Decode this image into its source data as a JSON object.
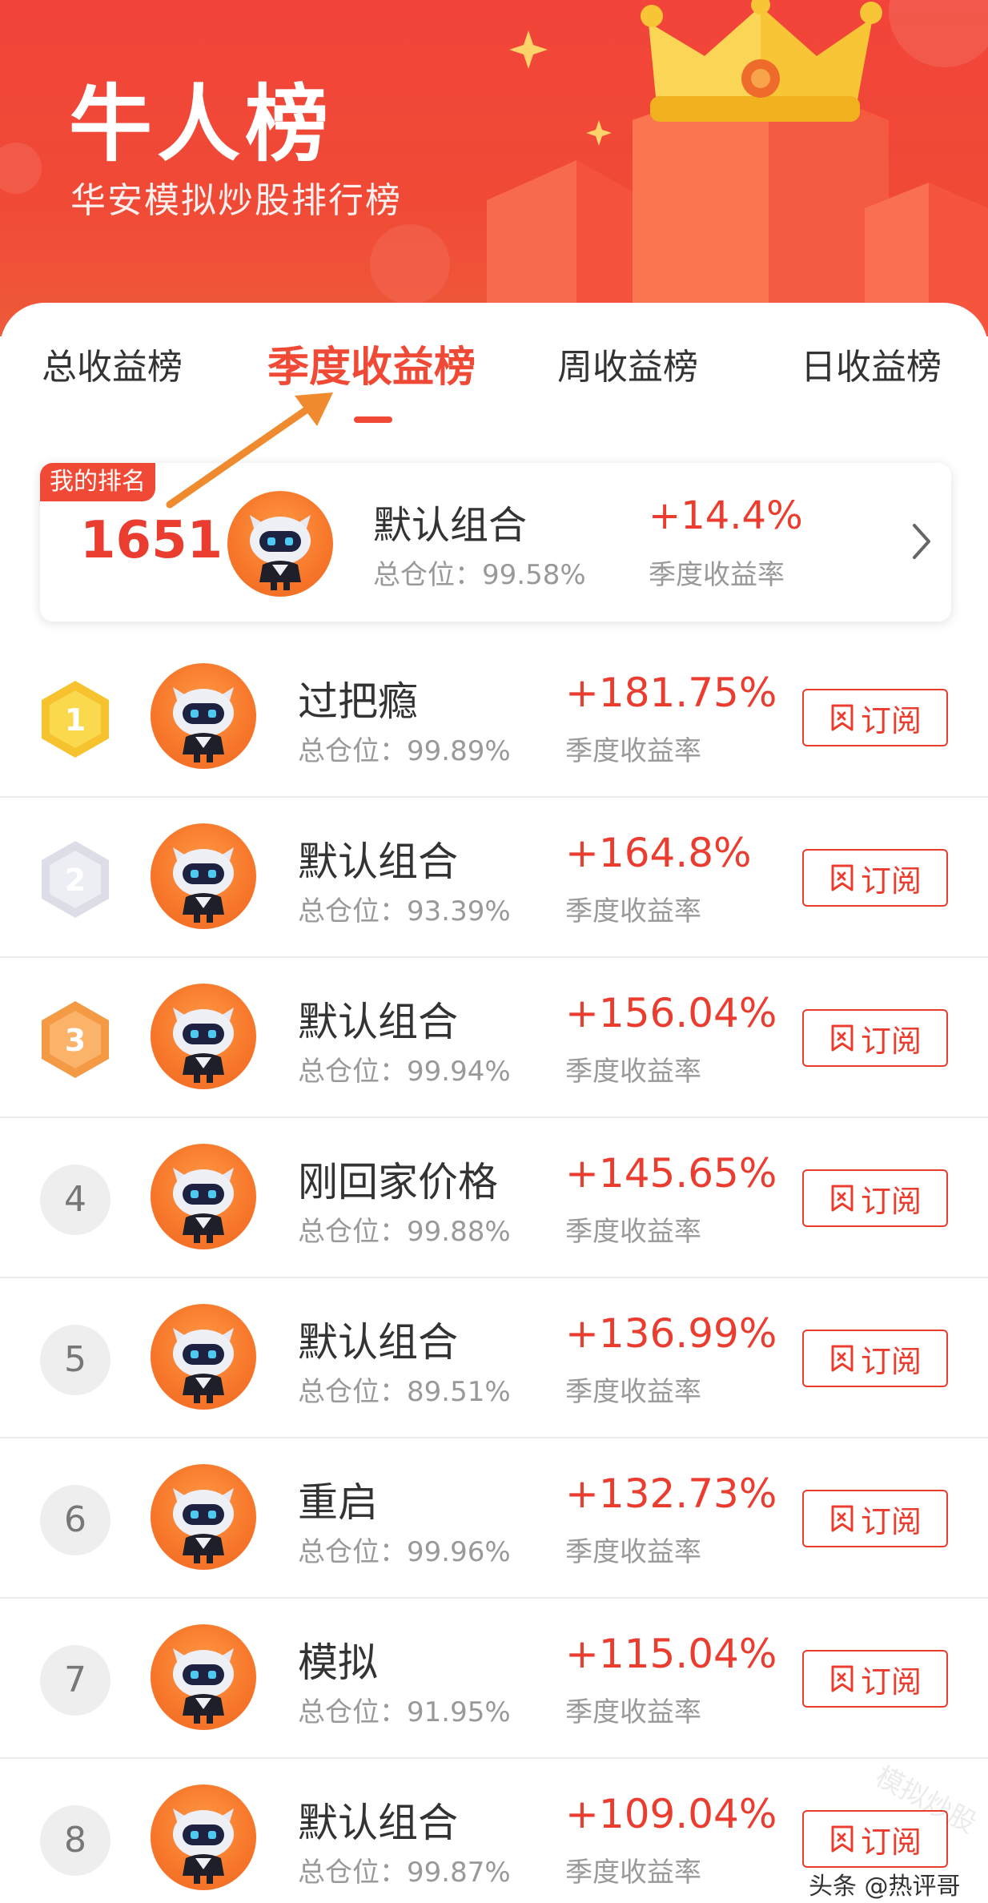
{
  "banner": {
    "title": "牛人榜",
    "subtitle": "华安模拟炒股排行榜"
  },
  "tabs": [
    {
      "label": "总收益榜",
      "active": false
    },
    {
      "label": "季度收益榜",
      "active": true
    },
    {
      "label": "周收益榜",
      "active": false
    },
    {
      "label": "日收益榜",
      "active": false
    }
  ],
  "my_rank": {
    "badge": "我的排名",
    "rank": "1651",
    "name": "默认组合",
    "position": "总仓位：99.58%",
    "return": "+14.4%",
    "return_label": "季度收益率"
  },
  "list": [
    {
      "rank": "1",
      "name": "过把瘾",
      "position": "总仓位：99.89%",
      "return": "+181.75%",
      "return_label": "季度收益率",
      "button": "订阅",
      "medal": "gold"
    },
    {
      "rank": "2",
      "name": "默认组合",
      "position": "总仓位：93.39%",
      "return": "+164.8%",
      "return_label": "季度收益率",
      "button": "订阅",
      "medal": "silver"
    },
    {
      "rank": "3",
      "name": "默认组合",
      "position": "总仓位：99.94%",
      "return": "+156.04%",
      "return_label": "季度收益率",
      "button": "订阅",
      "medal": "bronze"
    },
    {
      "rank": "4",
      "name": "刚回家价格",
      "position": "总仓位：99.88%",
      "return": "+145.65%",
      "return_label": "季度收益率",
      "button": "订阅",
      "medal": "none"
    },
    {
      "rank": "5",
      "name": "默认组合",
      "position": "总仓位：89.51%",
      "return": "+136.99%",
      "return_label": "季度收益率",
      "button": "订阅",
      "medal": "none"
    },
    {
      "rank": "6",
      "name": "重启",
      "position": "总仓位：99.96%",
      "return": "+132.73%",
      "return_label": "季度收益率",
      "button": "订阅",
      "medal": "none"
    },
    {
      "rank": "7",
      "name": "模拟",
      "position": "总仓位：91.95%",
      "return": "+115.04%",
      "return_label": "季度收益率",
      "button": "订阅",
      "medal": "none"
    },
    {
      "rank": "8",
      "name": "默认组合",
      "position": "总仓位：99.87%",
      "return": "+109.04%",
      "return_label": "季度收益率",
      "button": "订阅",
      "medal": "none"
    }
  ],
  "watermark": "头条 @热评哥",
  "stamp": "模拟炒股",
  "colors": {
    "accent": "#ea3d2f",
    "banner": "#f2443a",
    "avatar": "#f7762a",
    "gold": "#f6c22e",
    "silver": "#dcdde6",
    "bronze": "#f49a45"
  },
  "icons": {
    "chevron": "chevron-right-icon",
    "subscribe": "bookmark-icon",
    "crown": "crown-icon",
    "avatar": "robot-mascot-icon"
  }
}
